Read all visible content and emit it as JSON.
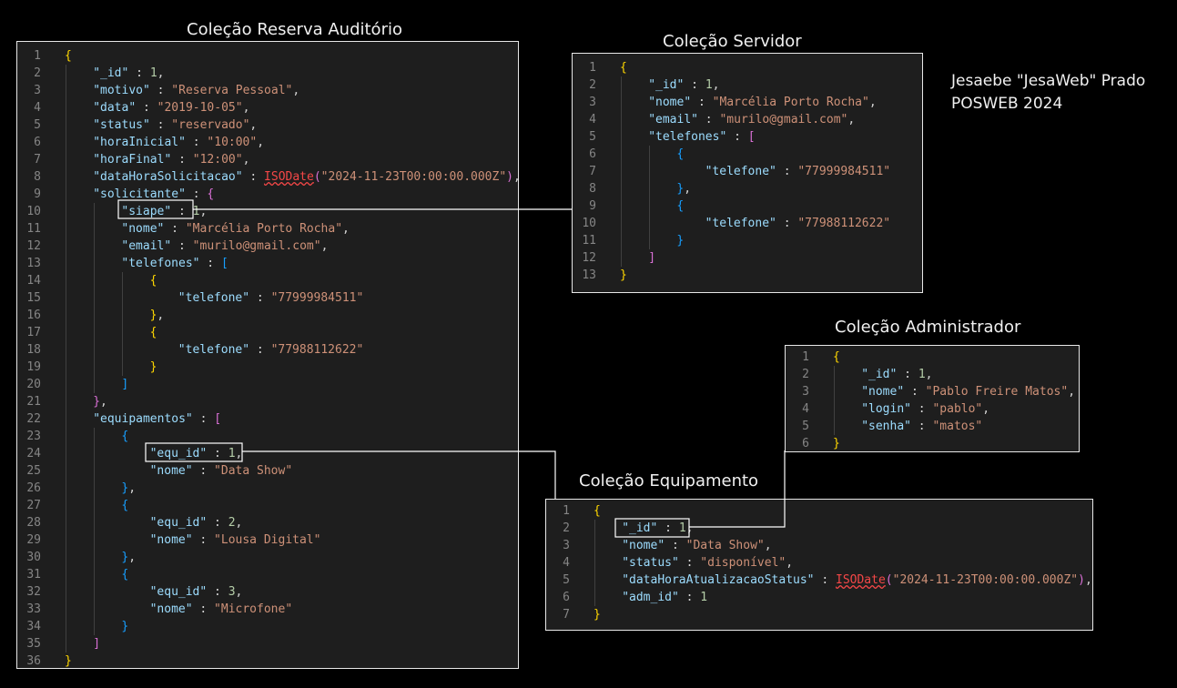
{
  "titles": {
    "reserva": "Coleção Reserva Auditório",
    "servidor": "Coleção Servidor",
    "administrador": "Coleção Administrador",
    "equipamento": "Coleção Equipamento"
  },
  "author": {
    "name": "Jesaebe \"JesaWeb\" Prado",
    "course": "POSWEB 2024"
  },
  "reserva_lines": [
    {
      "n": "1",
      "t": [
        [
          "b1",
          "{"
        ]
      ]
    },
    {
      "n": "2",
      "t": [
        [
          "k",
          "\"_id\""
        ],
        [
          "p",
          " : "
        ],
        [
          "n",
          "1"
        ],
        [
          "p",
          ","
        ]
      ]
    },
    {
      "n": "3",
      "t": [
        [
          "k",
          "\"motivo\""
        ],
        [
          "p",
          " : "
        ],
        [
          "s",
          "\"Reserva Pessoal\""
        ],
        [
          "p",
          ","
        ]
      ]
    },
    {
      "n": "4",
      "t": [
        [
          "k",
          "\"data\""
        ],
        [
          "p",
          " : "
        ],
        [
          "s",
          "\"2019-10-05\""
        ],
        [
          "p",
          ","
        ]
      ]
    },
    {
      "n": "5",
      "t": [
        [
          "k",
          "\"status\""
        ],
        [
          "p",
          " : "
        ],
        [
          "s",
          "\"reservado\""
        ],
        [
          "p",
          ","
        ]
      ]
    },
    {
      "n": "6",
      "t": [
        [
          "k",
          "\"horaInicial\""
        ],
        [
          "p",
          " : "
        ],
        [
          "s",
          "\"10:00\""
        ],
        [
          "p",
          ","
        ]
      ]
    },
    {
      "n": "7",
      "t": [
        [
          "k",
          "\"horaFinal\""
        ],
        [
          "p",
          " : "
        ],
        [
          "s",
          "\"12:00\""
        ],
        [
          "p",
          ","
        ]
      ]
    },
    {
      "n": "8",
      "t": [
        [
          "k",
          "\"dataHoraSolicitacao\""
        ],
        [
          "p",
          " : "
        ],
        [
          "fn",
          "ISODate"
        ],
        [
          "b2",
          "("
        ],
        [
          "s",
          "\"2024-11-23T00:00:00.000Z\""
        ],
        [
          "b2",
          ")"
        ],
        [
          "p",
          ","
        ]
      ]
    },
    {
      "n": "9",
      "t": [
        [
          "k",
          "\"solicitante\""
        ],
        [
          "p",
          " : "
        ],
        [
          "b2",
          "{"
        ]
      ]
    },
    {
      "n": "10",
      "t": [
        [
          "k",
          "\"siape\""
        ],
        [
          "p",
          " : "
        ],
        [
          "n",
          "1"
        ],
        [
          "p",
          ","
        ]
      ]
    },
    {
      "n": "11",
      "t": [
        [
          "k",
          "\"nome\""
        ],
        [
          "p",
          " : "
        ],
        [
          "s",
          "\"Marcélia Porto Rocha\""
        ],
        [
          "p",
          ","
        ]
      ]
    },
    {
      "n": "12",
      "t": [
        [
          "k",
          "\"email\""
        ],
        [
          "p",
          " : "
        ],
        [
          "s",
          "\"murilo@gmail.com\""
        ],
        [
          "p",
          ","
        ]
      ]
    },
    {
      "n": "13",
      "t": [
        [
          "k",
          "\"telefones\""
        ],
        [
          "p",
          " : "
        ],
        [
          "b3",
          "["
        ]
      ]
    },
    {
      "n": "14",
      "t": [
        [
          "b1",
          "{"
        ]
      ]
    },
    {
      "n": "15",
      "t": [
        [
          "k",
          "\"telefone\""
        ],
        [
          "p",
          " : "
        ],
        [
          "s",
          "\"77999984511\""
        ]
      ]
    },
    {
      "n": "16",
      "t": [
        [
          "b1",
          "}"
        ],
        [
          "p",
          ","
        ]
      ]
    },
    {
      "n": "17",
      "t": [
        [
          "b1",
          "{"
        ]
      ]
    },
    {
      "n": "18",
      "t": [
        [
          "k",
          "\"telefone\""
        ],
        [
          "p",
          " : "
        ],
        [
          "s",
          "\"77988112622\""
        ]
      ]
    },
    {
      "n": "19",
      "t": [
        [
          "b1",
          "}"
        ]
      ]
    },
    {
      "n": "20",
      "t": [
        [
          "b3",
          "]"
        ]
      ]
    },
    {
      "n": "21",
      "t": [
        [
          "b2",
          "}"
        ],
        [
          "p",
          ","
        ]
      ]
    },
    {
      "n": "22",
      "t": [
        [
          "k",
          "\"equipamentos\""
        ],
        [
          "p",
          " : "
        ],
        [
          "b2",
          "["
        ]
      ]
    },
    {
      "n": "23",
      "t": [
        [
          "b3",
          "{"
        ]
      ]
    },
    {
      "n": "24",
      "t": [
        [
          "k",
          "\"equ_id\""
        ],
        [
          "p",
          " : "
        ],
        [
          "n",
          "1"
        ],
        [
          "p",
          ","
        ]
      ]
    },
    {
      "n": "25",
      "t": [
        [
          "k",
          "\"nome\""
        ],
        [
          "p",
          " : "
        ],
        [
          "s",
          "\"Data Show\""
        ]
      ]
    },
    {
      "n": "26",
      "t": [
        [
          "b3",
          "}"
        ],
        [
          "p",
          ","
        ]
      ]
    },
    {
      "n": "27",
      "t": [
        [
          "b3",
          "{"
        ]
      ]
    },
    {
      "n": "28",
      "t": [
        [
          "k",
          "\"equ_id\""
        ],
        [
          "p",
          " : "
        ],
        [
          "n",
          "2"
        ],
        [
          "p",
          ","
        ]
      ]
    },
    {
      "n": "29",
      "t": [
        [
          "k",
          "\"nome\""
        ],
        [
          "p",
          " : "
        ],
        [
          "s",
          "\"Lousa Digital\""
        ]
      ]
    },
    {
      "n": "30",
      "t": [
        [
          "b3",
          "}"
        ],
        [
          "p",
          ","
        ]
      ]
    },
    {
      "n": "31",
      "t": [
        [
          "b3",
          "{"
        ]
      ]
    },
    {
      "n": "32",
      "t": [
        [
          "k",
          "\"equ_id\""
        ],
        [
          "p",
          " : "
        ],
        [
          "n",
          "3"
        ],
        [
          "p",
          ","
        ]
      ]
    },
    {
      "n": "33",
      "t": [
        [
          "k",
          "\"nome\""
        ],
        [
          "p",
          " : "
        ],
        [
          "s",
          "\"Microfone\""
        ]
      ]
    },
    {
      "n": "34",
      "t": [
        [
          "b3",
          "}"
        ]
      ]
    },
    {
      "n": "35",
      "t": [
        [
          "b2",
          "]"
        ]
      ]
    },
    {
      "n": "36",
      "t": [
        [
          "b1",
          "}"
        ]
      ]
    }
  ],
  "servidor_lines": [
    {
      "n": "1",
      "t": [
        [
          "b1",
          "{"
        ]
      ]
    },
    {
      "n": "2",
      "t": [
        [
          "k",
          "\"_id\""
        ],
        [
          "p",
          " : "
        ],
        [
          "n",
          "1"
        ],
        [
          "p",
          ","
        ]
      ]
    },
    {
      "n": "3",
      "t": [
        [
          "k",
          "\"nome\""
        ],
        [
          "p",
          " : "
        ],
        [
          "s",
          "\"Marcélia Porto Rocha\""
        ],
        [
          "p",
          ","
        ]
      ]
    },
    {
      "n": "4",
      "t": [
        [
          "k",
          "\"email\""
        ],
        [
          "p",
          " : "
        ],
        [
          "s",
          "\"murilo@gmail.com\""
        ],
        [
          "p",
          ","
        ]
      ]
    },
    {
      "n": "5",
      "t": [
        [
          "k",
          "\"telefones\""
        ],
        [
          "p",
          " : "
        ],
        [
          "b2",
          "["
        ]
      ]
    },
    {
      "n": "6",
      "t": [
        [
          "b3",
          "{"
        ]
      ]
    },
    {
      "n": "7",
      "t": [
        [
          "k",
          "\"telefone\""
        ],
        [
          "p",
          " : "
        ],
        [
          "s",
          "\"77999984511\""
        ]
      ]
    },
    {
      "n": "8",
      "t": [
        [
          "b3",
          "}"
        ],
        [
          "p",
          ","
        ]
      ]
    },
    {
      "n": "9",
      "t": [
        [
          "b3",
          "{"
        ]
      ]
    },
    {
      "n": "10",
      "t": [
        [
          "k",
          "\"telefone\""
        ],
        [
          "p",
          " : "
        ],
        [
          "s",
          "\"77988112622\""
        ]
      ]
    },
    {
      "n": "11",
      "t": [
        [
          "b3",
          "}"
        ]
      ]
    },
    {
      "n": "12",
      "t": [
        [
          "b2",
          "]"
        ]
      ]
    },
    {
      "n": "13",
      "t": [
        [
          "b1",
          "}"
        ]
      ]
    }
  ],
  "administrador_lines": [
    {
      "n": "1",
      "t": [
        [
          "b1",
          "{"
        ]
      ]
    },
    {
      "n": "2",
      "t": [
        [
          "k",
          "\"_id\""
        ],
        [
          "p",
          " : "
        ],
        [
          "n",
          "1"
        ],
        [
          "p",
          ","
        ]
      ]
    },
    {
      "n": "3",
      "t": [
        [
          "k",
          "\"nome\""
        ],
        [
          "p",
          " : "
        ],
        [
          "s",
          "\"Pablo Freire Matos\""
        ],
        [
          "p",
          ","
        ]
      ]
    },
    {
      "n": "4",
      "t": [
        [
          "k",
          "\"login\""
        ],
        [
          "p",
          " : "
        ],
        [
          "s",
          "\"pablo\""
        ],
        [
          "p",
          ","
        ]
      ]
    },
    {
      "n": "5",
      "t": [
        [
          "k",
          "\"senha\""
        ],
        [
          "p",
          " : "
        ],
        [
          "s",
          "\"matos\""
        ]
      ]
    },
    {
      "n": "6",
      "t": [
        [
          "b1",
          "}"
        ]
      ]
    }
  ],
  "equipamento_lines": [
    {
      "n": "1",
      "t": [
        [
          "b1",
          "{"
        ]
      ]
    },
    {
      "n": "2",
      "t": [
        [
          "k",
          "\"_id\""
        ],
        [
          "p",
          " : "
        ],
        [
          "n",
          "1"
        ],
        [
          "p",
          ","
        ]
      ]
    },
    {
      "n": "3",
      "t": [
        [
          "k",
          "\"nome\""
        ],
        [
          "p",
          " : "
        ],
        [
          "s",
          "\"Data Show\""
        ],
        [
          "p",
          ","
        ]
      ]
    },
    {
      "n": "4",
      "t": [
        [
          "k",
          "\"status\""
        ],
        [
          "p",
          " : "
        ],
        [
          "s",
          "\"disponível\""
        ],
        [
          "p",
          ","
        ]
      ]
    },
    {
      "n": "5",
      "t": [
        [
          "k",
          "\"dataHoraAtualizacaoStatus\""
        ],
        [
          "p",
          " : "
        ],
        [
          "fn",
          "ISODate"
        ],
        [
          "b2",
          "("
        ],
        [
          "s",
          "\"2024-11-23T00:00:00.000Z\""
        ],
        [
          "b2",
          ")"
        ],
        [
          "p",
          ","
        ]
      ]
    },
    {
      "n": "6",
      "t": [
        [
          "k",
          "\"adm_id\""
        ],
        [
          "p",
          " : "
        ],
        [
          "n",
          "1"
        ]
      ]
    },
    {
      "n": "7",
      "t": [
        [
          "b1",
          "}"
        ]
      ]
    }
  ]
}
